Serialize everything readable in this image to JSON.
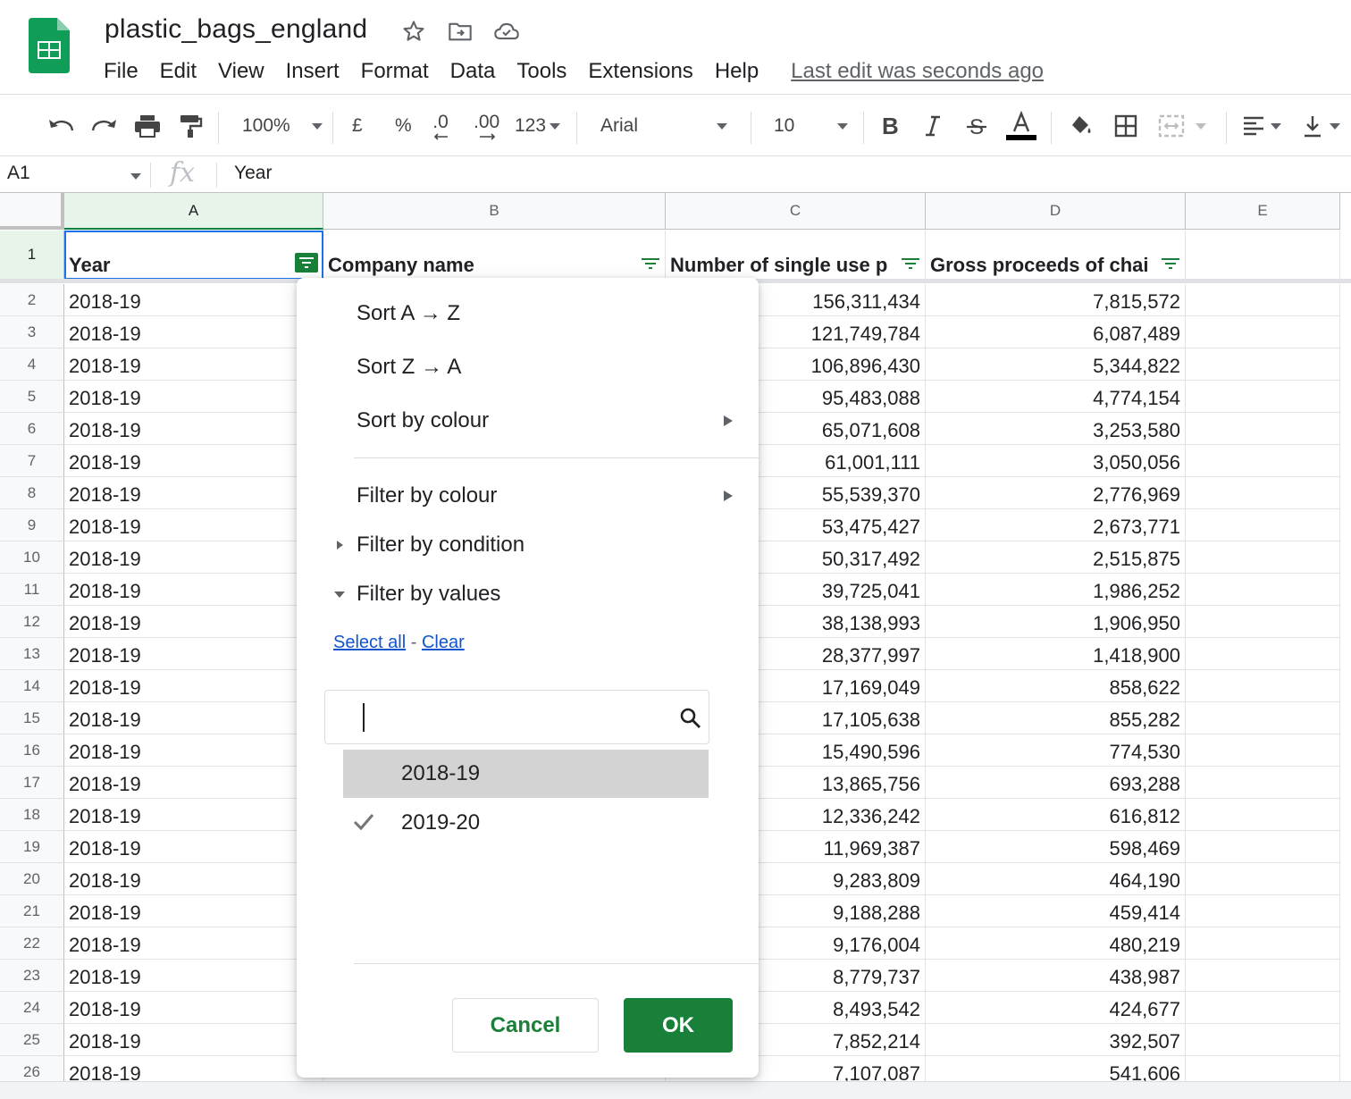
{
  "doc": {
    "title": "plastic_bags_england",
    "last_edit": "Last edit was seconds ago"
  },
  "menu": [
    "File",
    "Edit",
    "View",
    "Insert",
    "Format",
    "Data",
    "Tools",
    "Extensions",
    "Help"
  ],
  "toolbar": {
    "zoom": "100%",
    "currency": "£",
    "percent": "%",
    "decrease_decimals": ".0",
    "increase_decimals": ".00",
    "more_formats": "123",
    "font": "Arial",
    "font_size": "10"
  },
  "formula_bar": {
    "cell_ref": "A1",
    "fx": "fx",
    "value": "Year"
  },
  "columns": [
    "A",
    "B",
    "C",
    "D",
    "E"
  ],
  "header_row": {
    "row_num": "1",
    "year": "Year",
    "company": "Company name",
    "number": "Number of single use p",
    "gross": "Gross proceeds of chai"
  },
  "rows": [
    {
      "n": "2",
      "year": "2018-19",
      "num": "156,311,434",
      "gross": "7,815,572"
    },
    {
      "n": "3",
      "year": "2018-19",
      "num": "121,749,784",
      "gross": "6,087,489"
    },
    {
      "n": "4",
      "year": "2018-19",
      "num": "106,896,430",
      "gross": "5,344,822"
    },
    {
      "n": "5",
      "year": "2018-19",
      "num": "95,483,088",
      "gross": "4,774,154"
    },
    {
      "n": "6",
      "year": "2018-19",
      "num": "65,071,608",
      "gross": "3,253,580"
    },
    {
      "n": "7",
      "year": "2018-19",
      "num": "61,001,111",
      "gross": "3,050,056"
    },
    {
      "n": "8",
      "year": "2018-19",
      "num": "55,539,370",
      "gross": "2,776,969"
    },
    {
      "n": "9",
      "year": "2018-19",
      "num": "53,475,427",
      "gross": "2,673,771"
    },
    {
      "n": "10",
      "year": "2018-19",
      "num": "50,317,492",
      "gross": "2,515,875"
    },
    {
      "n": "11",
      "year": "2018-19",
      "num": "39,725,041",
      "gross": "1,986,252"
    },
    {
      "n": "12",
      "year": "2018-19",
      "num": "38,138,993",
      "gross": "1,906,950"
    },
    {
      "n": "13",
      "year": "2018-19",
      "num": "28,377,997",
      "gross": "1,418,900"
    },
    {
      "n": "14",
      "year": "2018-19",
      "num": "17,169,049",
      "gross": "858,622"
    },
    {
      "n": "15",
      "year": "2018-19",
      "num": "17,105,638",
      "gross": "855,282"
    },
    {
      "n": "16",
      "year": "2018-19",
      "num": "15,490,596",
      "gross": "774,530"
    },
    {
      "n": "17",
      "year": "2018-19",
      "num": "13,865,756",
      "gross": "693,288"
    },
    {
      "n": "18",
      "year": "2018-19",
      "num": "12,336,242",
      "gross": "616,812"
    },
    {
      "n": "19",
      "year": "2018-19",
      "num": "11,969,387",
      "gross": "598,469"
    },
    {
      "n": "20",
      "year": "2018-19",
      "num": "9,283,809",
      "gross": "464,190"
    },
    {
      "n": "21",
      "year": "2018-19",
      "num": "9,188,288",
      "gross": "459,414"
    },
    {
      "n": "22",
      "year": "2018-19",
      "num": "9,176,004",
      "gross": "480,219"
    },
    {
      "n": "23",
      "year": "2018-19",
      "num": "8,779,737",
      "gross": "438,987"
    },
    {
      "n": "24",
      "year": "2018-19",
      "num": "8,493,542",
      "gross": "424,677"
    },
    {
      "n": "25",
      "year": "2018-19",
      "num": "7,852,214",
      "gross": "392,507"
    },
    {
      "n": "26",
      "year": "2018-19",
      "num": "7,107,087",
      "gross": "541,606"
    }
  ],
  "filter_menu": {
    "sort_az": "Sort A → Z",
    "sort_za": "Sort Z → A",
    "sort_colour": "Sort by colour",
    "filter_colour": "Filter by colour",
    "filter_condition": "Filter by condition",
    "filter_values": "Filter by values",
    "select_all": "Select all",
    "link_sep": " - ",
    "clear": "Clear",
    "search_value": "",
    "values": [
      {
        "label": "2018-19",
        "checked": false,
        "highlighted": true
      },
      {
        "label": "2019-20",
        "checked": true,
        "highlighted": false
      }
    ],
    "cancel": "Cancel",
    "ok": "OK"
  },
  "colors": {
    "accent_green": "#188038",
    "selection_blue": "#1a73e8",
    "link_blue": "#1155cc"
  }
}
